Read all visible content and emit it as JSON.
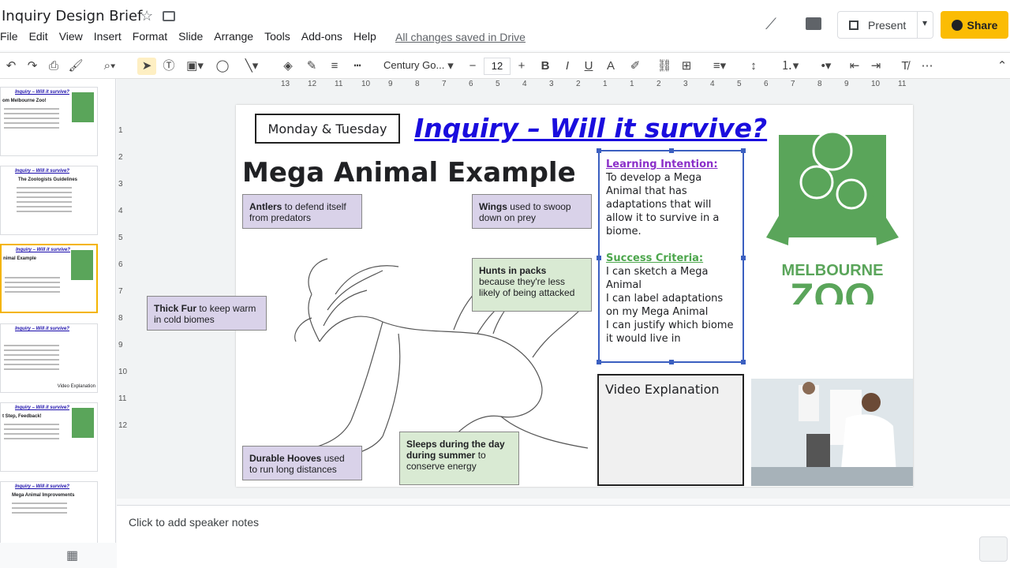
{
  "doc": {
    "title": "Inquiry Design Brief",
    "saved_status": "All changes saved in Drive"
  },
  "menu": [
    "File",
    "Edit",
    "View",
    "Insert",
    "Format",
    "Slide",
    "Arrange",
    "Tools",
    "Add-ons",
    "Help"
  ],
  "header": {
    "present_label": "Present",
    "share_label": "Share"
  },
  "toolbar": {
    "font_name": "Century Go...",
    "font_size": "12"
  },
  "ruler_top": [
    "13",
    "12",
    "11",
    "10",
    "9",
    "8",
    "7",
    "6",
    "5",
    "4",
    "3",
    "2",
    "1",
    "1",
    "2",
    "3",
    "4",
    "5",
    "6",
    "7",
    "8",
    "9",
    "10",
    "11"
  ],
  "ruler_left": [
    "1",
    "2",
    "3",
    "4",
    "5",
    "6",
    "7",
    "8",
    "9",
    "10",
    "11",
    "12"
  ],
  "filmstrip": [
    {
      "title": "Inquiry – Will it survive?",
      "heading": "om Melbourne Zoo!"
    },
    {
      "title": "Inquiry – Will it survive?",
      "heading": "The Zoologists Guidelines"
    },
    {
      "title": "Inquiry – Will it survive?",
      "heading": "nimal Example"
    },
    {
      "title": "Inquiry – Will it survive?",
      "heading": "Video Explanation"
    },
    {
      "title": "Inquiry – Will it survive?",
      "heading": "t Step, Feedback!"
    },
    {
      "title": "Inquiry – Will it survive?",
      "heading": "Mega Animal Improvements"
    }
  ],
  "slide": {
    "day": "Monday & Tuesday",
    "title": "Inquiry – Will it survive?",
    "subtitle": "Mega Animal Example",
    "labels": {
      "antlers_bold": "Antlers",
      "antlers_rest": " to defend itself from predators",
      "wings_bold": "Wings",
      "wings_rest": " used to swoop down on prey",
      "hunts_bold": "Hunts in packs",
      "hunts_rest": "because they're less likely of being attacked",
      "fur_bold": "Thick Fur",
      "fur_rest": " to keep warm in cold biomes",
      "hooves_bold": "Durable Hooves",
      "hooves_rest": " used to run long distances",
      "sleeps_bold": "Sleeps during the day during summer",
      "sleeps_rest": " to conserve energy"
    },
    "learning_intention_head": "Learning Intention:",
    "learning_intention_text": "To develop a Mega Animal that has adaptations that will allow it to survive in a biome.",
    "success_criteria_head": "Success Criteria:",
    "success_criteria": [
      "I can sketch a Mega Animal",
      "I can label adaptations on my Mega Animal",
      "I can justify which biome it would live in"
    ],
    "video_label": "Video Explanation",
    "logo_text_1": "MELBOURNE",
    "logo_text_2": "ZOO"
  },
  "notes": {
    "placeholder": "Click to add speaker notes"
  },
  "colors": {
    "share": "#fbbc04",
    "title_blue": "#1a0dde",
    "zoo_green": "#5aa55a",
    "label_purple": "#d9d2e9",
    "label_green": "#d9ead3"
  }
}
